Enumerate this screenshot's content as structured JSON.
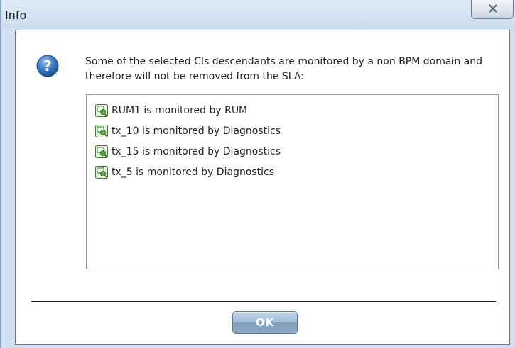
{
  "window": {
    "title": "Info"
  },
  "message": {
    "text": "Some of the selected CIs descendants are monitored by a non BPM domain and therefore will not be removed from the SLA:"
  },
  "items": [
    {
      "label": "RUM1 is monitored by RUM",
      "icon": "monitor-icon"
    },
    {
      "label": "tx_10 is monitored by Diagnostics",
      "icon": "monitor-icon"
    },
    {
      "label": "tx_15 is monitored by Diagnostics",
      "icon": "monitor-icon"
    },
    {
      "label": "tx_5 is monitored by Diagnostics",
      "icon": "monitor-icon"
    }
  ],
  "buttons": {
    "ok_label": "OK"
  },
  "colors": {
    "frame": "#cfdff0",
    "help_icon": "#3a78c3",
    "item_icon": "#5cae3c"
  }
}
